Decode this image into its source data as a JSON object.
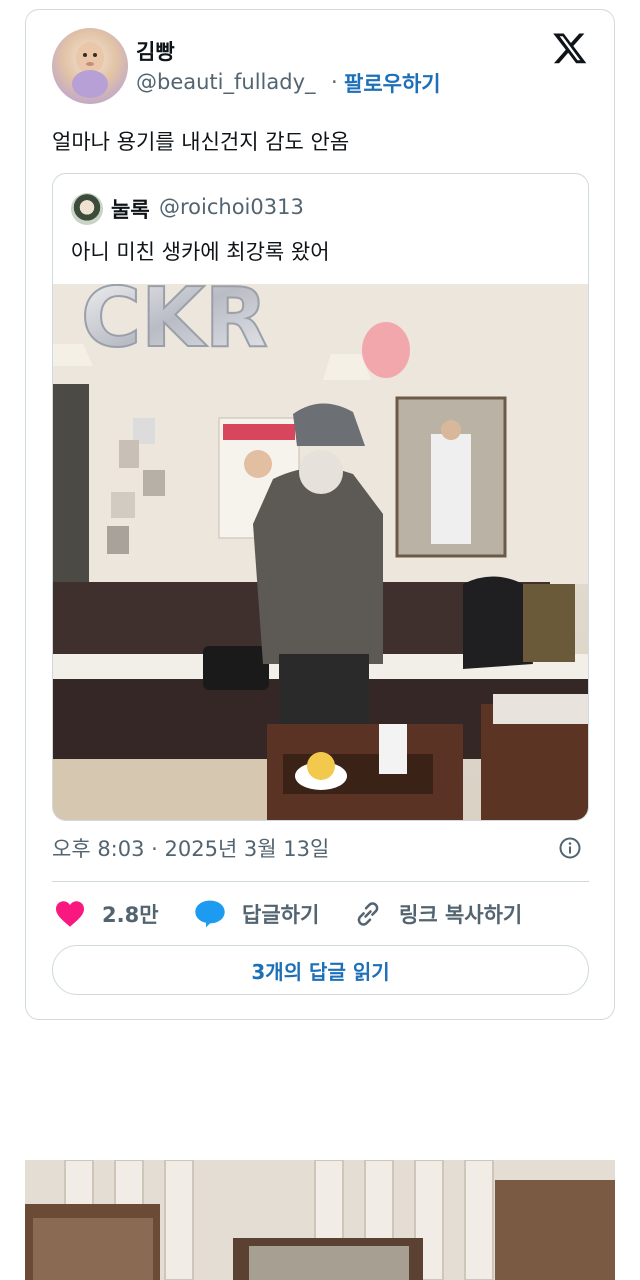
{
  "tweet": {
    "author_name": "김빵",
    "author_handle": "@beauti_fullady_",
    "separator": "·",
    "follow_label": "팔로우하기",
    "text": "얼마나 용기를 내신건지 감도 안옴",
    "timestamp": "오후 8:03 · 2025년 3월 13일",
    "likes_count": "2.8만",
    "reply_label": "답글하기",
    "copy_link_label": "링크 복사하기",
    "read_replies_label": "3개의 답글 읽기",
    "colors": {
      "like": "#f91880",
      "reply": "#1d9bf0",
      "link_blue": "#1d6fb8"
    }
  },
  "quoted_tweet": {
    "author_name": "눌록",
    "author_handle": "@roichoi0313",
    "text": "아니 미친 생카에 최강록 왔어",
    "photo_banner_text": "CKR"
  },
  "icons": [
    "x-logo-icon",
    "info-icon",
    "heart-icon",
    "reply-bubble-icon",
    "link-icon"
  ]
}
